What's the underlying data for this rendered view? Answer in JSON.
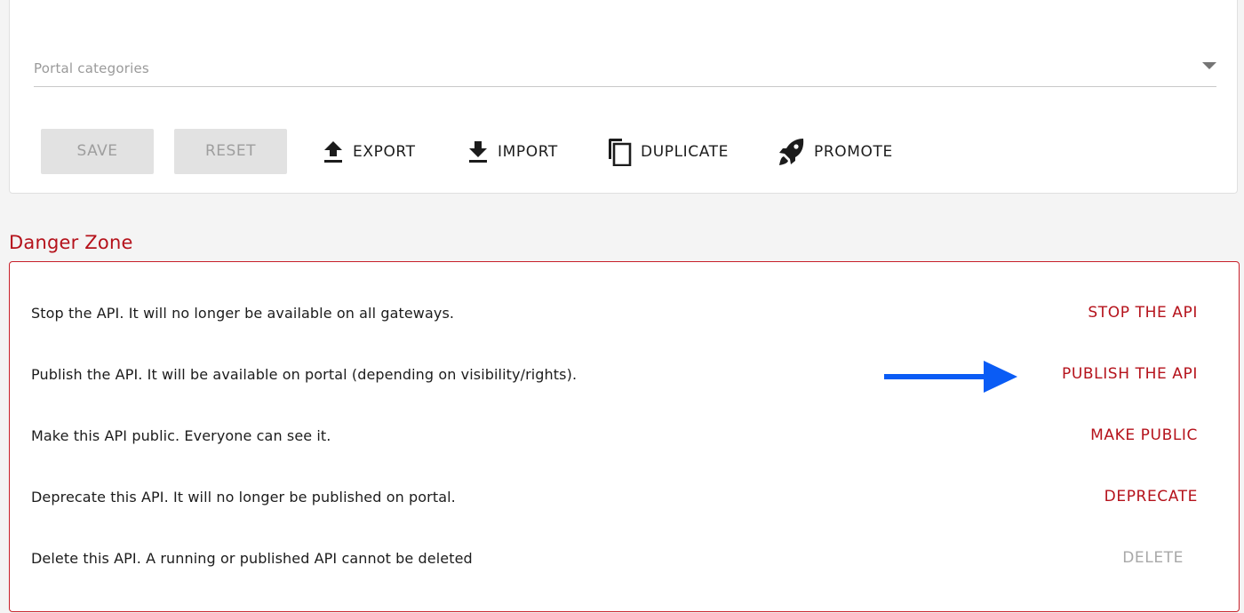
{
  "settings": {
    "categories_placeholder": "Portal categories",
    "save_label": "SAVE",
    "reset_label": "RESET",
    "export_label": "EXPORT",
    "import_label": "IMPORT",
    "duplicate_label": "DUPLICATE",
    "promote_label": "PROMOTE"
  },
  "danger_zone": {
    "title": "Danger Zone",
    "rows": [
      {
        "description": "Stop the API. It will no longer be available on all gateways.",
        "action": "STOP THE API"
      },
      {
        "description": "Publish the API. It will be available on portal (depending on visibility/rights).",
        "action": "PUBLISH THE API"
      },
      {
        "description": "Make this API public. Everyone can see it.",
        "action": "MAKE PUBLIC"
      },
      {
        "description": "Deprecate this API. It will no longer be published on portal.",
        "action": "DEPRECATE"
      },
      {
        "description": "Delete this API. A running or published API cannot be deleted",
        "action": "DELETE"
      }
    ]
  },
  "colors": {
    "danger": "#b5121b",
    "annotation_arrow": "#0a5cf5",
    "disabled": "#a8a8a8"
  },
  "icons": [
    "caret-down-icon",
    "upload-icon",
    "download-icon",
    "copy-icon",
    "rocket-icon",
    "arrow-right-icon"
  ]
}
